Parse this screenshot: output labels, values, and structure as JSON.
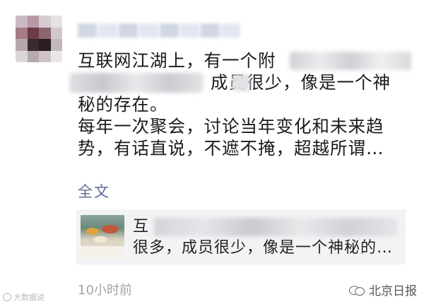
{
  "post": {
    "lines": [
      "互联网江湖上，有一个附",
      "成员很少，像是一个神",
      "秘的存在。",
      "每年一次聚会，讨论当年变化和未来趋",
      "势，有话直说，不遮不掩，超越所谓…"
    ],
    "full_text_link": "全文",
    "timestamp": "10小时前"
  },
  "link_card": {
    "line1": "互",
    "line2": "很多，成员很少，像是一个神秘的…"
  },
  "watermarks": {
    "left": "大数据说",
    "right": "北京日报"
  },
  "colors": {
    "link": "#5b6b8f",
    "card_bg": "#f3f3f5",
    "timestamp": "#a4a4a4"
  },
  "icons": {
    "avatar": "mosaic-avatar",
    "wechat": "wechat-bubbles-icon"
  }
}
